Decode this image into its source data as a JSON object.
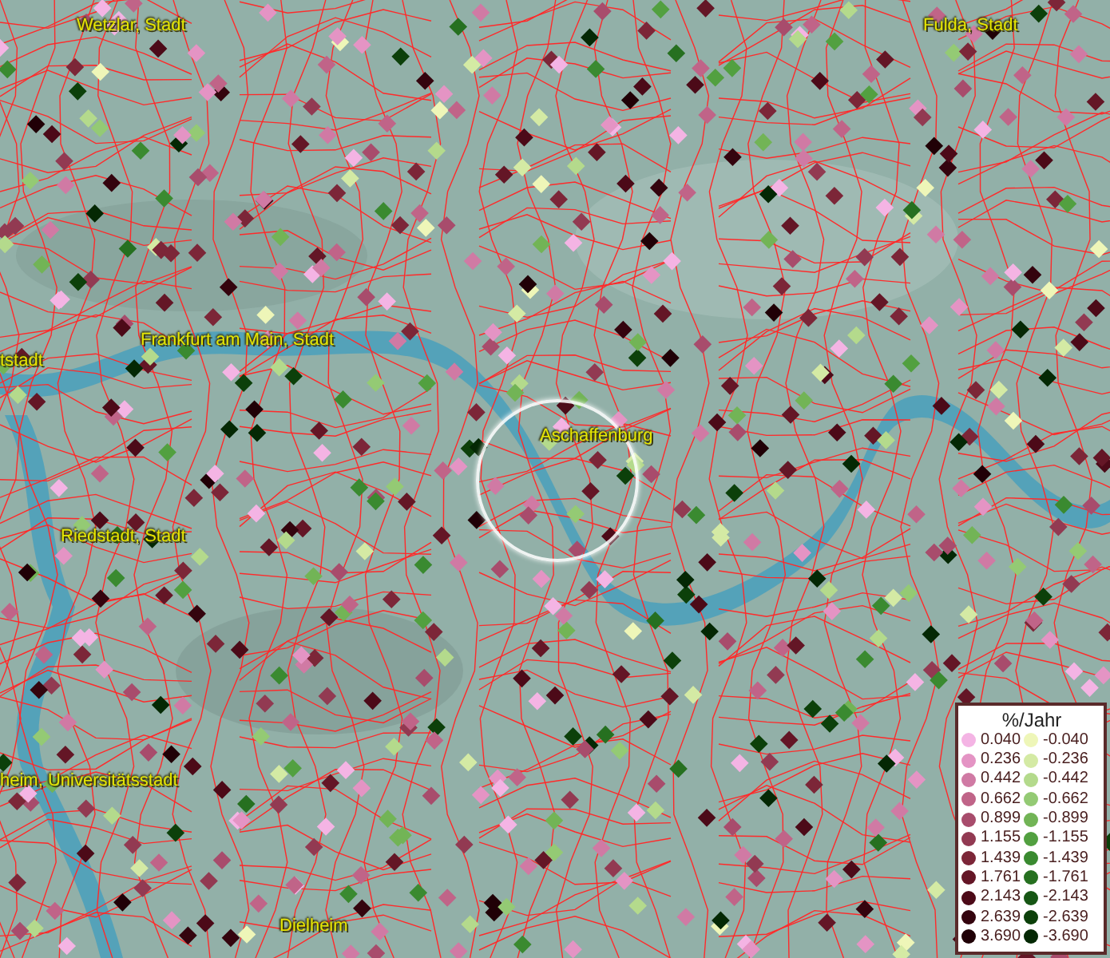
{
  "map": {
    "labels": [
      {
        "text": "Wetzlar, Stadt"
      },
      {
        "text": "Fulda, Stadt"
      },
      {
        "text": "Frankfurt am Main, Stadt"
      },
      {
        "text": "tstadt"
      },
      {
        "text": "Aschaffenburg"
      },
      {
        "text": "Riedstadt, Stadt"
      },
      {
        "text": "heim, Universitätsstadt"
      },
      {
        "text": "Dielheim"
      }
    ]
  },
  "legend": {
    "title": "%/Jahr",
    "columns": [
      [
        {
          "label": "0.040",
          "color": "#f4b4e4"
        },
        {
          "label": "0.236",
          "color": "#e494c4"
        },
        {
          "label": "0.442",
          "color": "#d07aa4"
        },
        {
          "label": "0.662",
          "color": "#c06488"
        },
        {
          "label": "0.899",
          "color": "#a84c6c"
        },
        {
          "label": "1.155",
          "color": "#923a52"
        },
        {
          "label": "1.439",
          "color": "#7c2638"
        },
        {
          "label": "1.761",
          "color": "#641626"
        },
        {
          "label": "2.143",
          "color": "#4c0a18"
        },
        {
          "label": "2.639",
          "color": "#34040e"
        },
        {
          "label": "3.690",
          "color": "#200006"
        }
      ],
      [
        {
          "label": "-0.040",
          "color": "#eef6b8"
        },
        {
          "label": "-0.236",
          "color": "#d4eaa4"
        },
        {
          "label": "-0.442",
          "color": "#b4da8c"
        },
        {
          "label": "-0.662",
          "color": "#94ca74"
        },
        {
          "label": "-0.899",
          "color": "#72b456"
        },
        {
          "label": "-1.155",
          "color": "#52a040"
        },
        {
          "label": "-1.439",
          "color": "#3a8a30"
        },
        {
          "label": "-1.761",
          "color": "#267020"
        },
        {
          "label": "-2.143",
          "color": "#165614"
        },
        {
          "label": "-2.639",
          "color": "#0c400a"
        },
        {
          "label": "-3.690",
          "color": "#042804"
        }
      ]
    ]
  }
}
